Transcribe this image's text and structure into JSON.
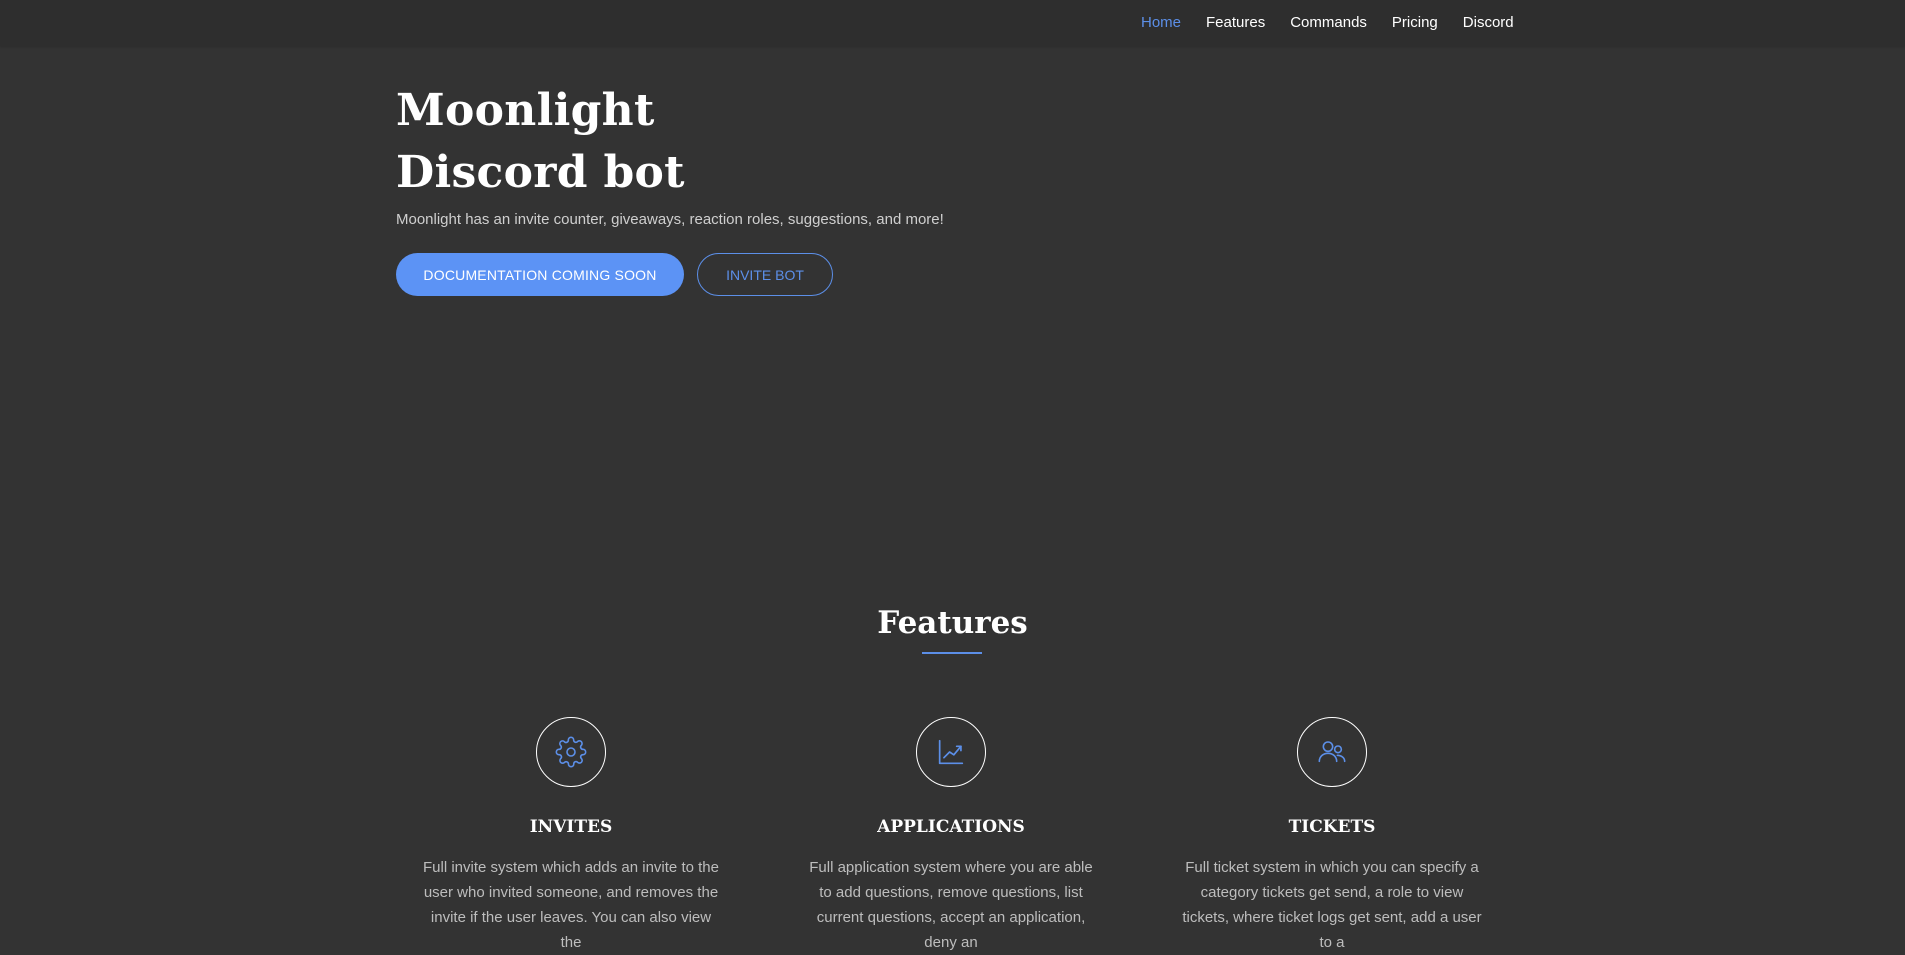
{
  "nav": {
    "items": [
      {
        "label": "Home",
        "active": true
      },
      {
        "label": "Features",
        "active": false
      },
      {
        "label": "Commands",
        "active": false
      },
      {
        "label": "Pricing",
        "active": false
      },
      {
        "label": "Discord",
        "active": false
      }
    ]
  },
  "hero": {
    "title_line1": "Moonlight",
    "title_line2": "Discord bot",
    "subtitle": "Moonlight has an invite counter, giveaways, reaction roles, suggestions, and more!",
    "primary_button": "DOCUMENTATION COMING SOON",
    "secondary_button": "INVITE BOT"
  },
  "features": {
    "title": "Features",
    "items": [
      {
        "icon": "gear-icon",
        "heading": "INVITES",
        "text": "Full invite system which adds an invite to the user who invited someone, and removes the invite if the user leaves. You can also view the"
      },
      {
        "icon": "chart-icon",
        "heading": "APPLICATIONS",
        "text": "Full application system where you are able to add questions, remove questions, list current questions, accept an application, deny an"
      },
      {
        "icon": "users-icon",
        "heading": "TICKETS",
        "text": "Full ticket system in which you can specify a category tickets get send, a role to view tickets, where ticket logs get sent, add a user to a"
      }
    ]
  },
  "colors": {
    "background": "#333333",
    "navbar": "#2e2e2e",
    "accent": "#5c8fe8",
    "primary_button": "#5c93f5"
  }
}
